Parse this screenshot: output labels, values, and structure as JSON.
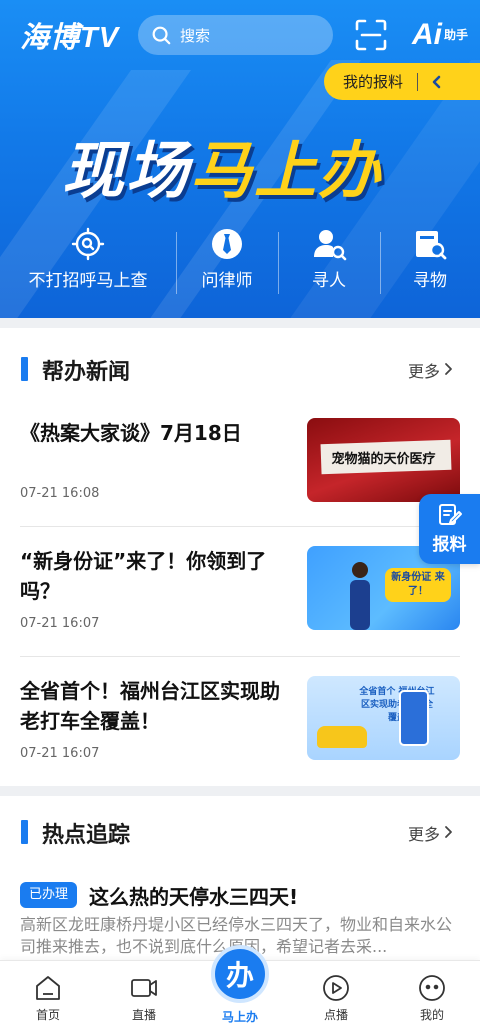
{
  "header": {
    "logo": "海博TV",
    "search_placeholder": "搜索",
    "ai_label": "Ai",
    "ai_sub": "助手",
    "my_report": "我的报料"
  },
  "banner": {
    "title_part1": "现场",
    "title_part2": "马上办"
  },
  "quick_actions": [
    {
      "label": "不打招呼马上查",
      "icon": "crosshair-search-icon"
    },
    {
      "label": "问律师",
      "icon": "lawyer-tie-icon"
    },
    {
      "label": "寻人",
      "icon": "person-search-icon"
    },
    {
      "label": "寻物",
      "icon": "item-search-icon"
    }
  ],
  "section_news": {
    "title": "帮办新闻",
    "more": "更多",
    "items": [
      {
        "title": "《热案大家谈》7月18日",
        "date": "07-21 16:08",
        "thumb_caption": "宠物猫的天价医疗"
      },
      {
        "title": "“新身份证”来了！你领到了吗？",
        "date": "07-21 16:07",
        "thumb_caption": "新身份证 来了！"
      },
      {
        "title": "全省首个！福州台江区实现助老打车全覆盖！",
        "date": "07-21 16:07",
        "thumb_caption": "全省首个 福州台江区实现助老打车全覆盖"
      }
    ]
  },
  "float_report": "报料",
  "section_hot": {
    "title": "热点追踪",
    "more": "更多",
    "item": {
      "tag": "已办理",
      "title": "这么热的天停水三四天!",
      "summary": "高新区龙旺康桥丹堤小区已经停水三四天了，物业和自来水公司推来推去，也不说到底什么原因，希望记者去采..."
    }
  },
  "bottom_nav": {
    "home": "首页",
    "live": "直播",
    "center": "马上办",
    "center_icon_char": "办",
    "vod": "点播",
    "mine": "我的"
  }
}
